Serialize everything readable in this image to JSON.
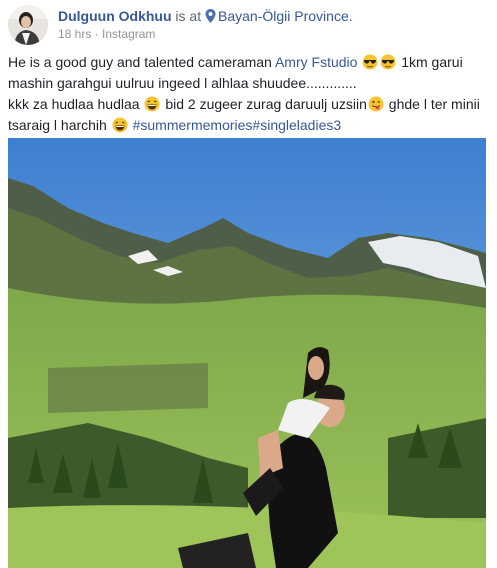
{
  "post": {
    "author": "Dulguun Odkhuu",
    "is_at": "is at",
    "location": "Bayan-Ölgii Province.",
    "timestamp": "18 hrs",
    "separator": "·",
    "source": "Instagram",
    "privacy_icon": "globe-icon"
  },
  "text": {
    "line1_a": "He is a good guy and talented cameraman",
    "mention": "Amry Fstudio",
    "line1_b": "1km garui",
    "line2": "mashin garahgui uulruu ingeed l alhlaa shuudee.............",
    "line3_a": "kkk za hudlaa hudlaa",
    "line3_b": "bid 2 zugeer zurag daruulj uzsiin",
    "line3_c": "ghde l ter minii",
    "line4_a": "tsaraig l harchih",
    "hashtag1": "#summermemories",
    "hashtag2": "#singleladies3"
  },
  "emojis": [
    "sunglasses-emoji",
    "laughing-emoji",
    "winking-tongue-emoji"
  ],
  "colors": {
    "link": "#365899",
    "meta": "#90949c",
    "text": "#1d2129"
  }
}
